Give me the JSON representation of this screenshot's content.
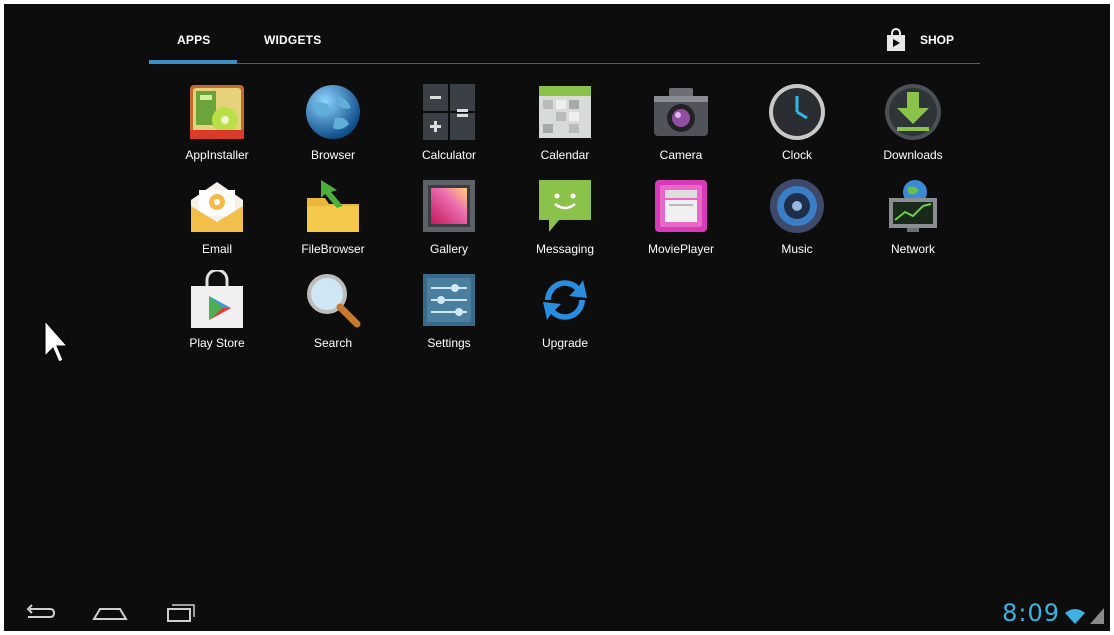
{
  "tabs": {
    "apps": "APPS",
    "widgets": "WIDGETS",
    "shop": "SHOP"
  },
  "apps": [
    {
      "label": "AppInstaller",
      "icon": "appinstaller-icon"
    },
    {
      "label": "Browser",
      "icon": "browser-globe-icon"
    },
    {
      "label": "Calculator",
      "icon": "calculator-icon"
    },
    {
      "label": "Calendar",
      "icon": "calendar-icon"
    },
    {
      "label": "Camera",
      "icon": "camera-icon"
    },
    {
      "label": "Clock",
      "icon": "clock-icon"
    },
    {
      "label": "Downloads",
      "icon": "downloads-icon"
    },
    {
      "label": "Email",
      "icon": "email-icon"
    },
    {
      "label": "FileBrowser",
      "icon": "filebrowser-icon"
    },
    {
      "label": "Gallery",
      "icon": "gallery-icon"
    },
    {
      "label": "Messaging",
      "icon": "messaging-icon"
    },
    {
      "label": "MoviePlayer",
      "icon": "movieplayer-icon"
    },
    {
      "label": "Music",
      "icon": "music-icon"
    },
    {
      "label": "Network",
      "icon": "network-icon"
    },
    {
      "label": "Play Store",
      "icon": "play-store-icon"
    },
    {
      "label": "Search",
      "icon": "search-icon"
    },
    {
      "label": "Settings",
      "icon": "settings-icon"
    },
    {
      "label": "Upgrade",
      "icon": "upgrade-icon"
    }
  ],
  "status": {
    "time": "8:09"
  },
  "colors": {
    "accent": "#3d8ec4",
    "clock": "#3fb0e0",
    "background": "#0d0d0d"
  }
}
